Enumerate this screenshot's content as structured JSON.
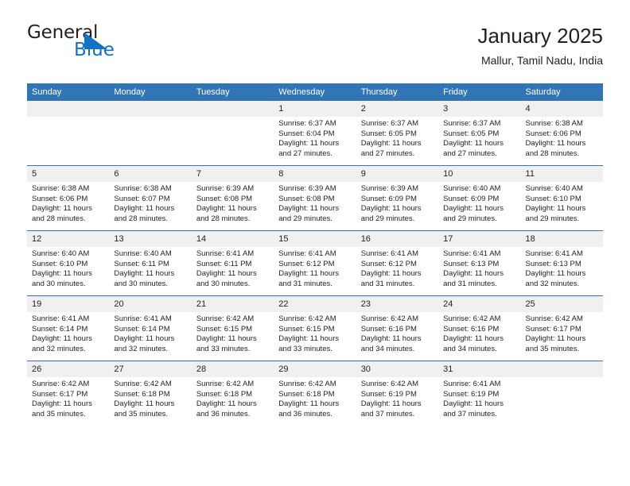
{
  "brand": {
    "name_part1": "General",
    "name_part2": "Blue",
    "mark": "triangle-icon"
  },
  "header": {
    "title": "January 2025",
    "location": "Mallur, Tamil Nadu, India"
  },
  "calendar": {
    "weekday_headers": [
      "Sunday",
      "Monday",
      "Tuesday",
      "Wednesday",
      "Thursday",
      "Friday",
      "Saturday"
    ],
    "accent_color": "#3275b6",
    "daynum_band_color": "#f0f0f0",
    "weeks": [
      [
        {
          "day": "",
          "sunrise": "",
          "sunset": "",
          "daylight1": "",
          "daylight2": ""
        },
        {
          "day": "",
          "sunrise": "",
          "sunset": "",
          "daylight1": "",
          "daylight2": ""
        },
        {
          "day": "",
          "sunrise": "",
          "sunset": "",
          "daylight1": "",
          "daylight2": ""
        },
        {
          "day": "1",
          "sunrise": "Sunrise: 6:37 AM",
          "sunset": "Sunset: 6:04 PM",
          "daylight1": "Daylight: 11 hours",
          "daylight2": "and 27 minutes."
        },
        {
          "day": "2",
          "sunrise": "Sunrise: 6:37 AM",
          "sunset": "Sunset: 6:05 PM",
          "daylight1": "Daylight: 11 hours",
          "daylight2": "and 27 minutes."
        },
        {
          "day": "3",
          "sunrise": "Sunrise: 6:37 AM",
          "sunset": "Sunset: 6:05 PM",
          "daylight1": "Daylight: 11 hours",
          "daylight2": "and 27 minutes."
        },
        {
          "day": "4",
          "sunrise": "Sunrise: 6:38 AM",
          "sunset": "Sunset: 6:06 PM",
          "daylight1": "Daylight: 11 hours",
          "daylight2": "and 28 minutes."
        }
      ],
      [
        {
          "day": "5",
          "sunrise": "Sunrise: 6:38 AM",
          "sunset": "Sunset: 6:06 PM",
          "daylight1": "Daylight: 11 hours",
          "daylight2": "and 28 minutes."
        },
        {
          "day": "6",
          "sunrise": "Sunrise: 6:38 AM",
          "sunset": "Sunset: 6:07 PM",
          "daylight1": "Daylight: 11 hours",
          "daylight2": "and 28 minutes."
        },
        {
          "day": "7",
          "sunrise": "Sunrise: 6:39 AM",
          "sunset": "Sunset: 6:08 PM",
          "daylight1": "Daylight: 11 hours",
          "daylight2": "and 28 minutes."
        },
        {
          "day": "8",
          "sunrise": "Sunrise: 6:39 AM",
          "sunset": "Sunset: 6:08 PM",
          "daylight1": "Daylight: 11 hours",
          "daylight2": "and 29 minutes."
        },
        {
          "day": "9",
          "sunrise": "Sunrise: 6:39 AM",
          "sunset": "Sunset: 6:09 PM",
          "daylight1": "Daylight: 11 hours",
          "daylight2": "and 29 minutes."
        },
        {
          "day": "10",
          "sunrise": "Sunrise: 6:40 AM",
          "sunset": "Sunset: 6:09 PM",
          "daylight1": "Daylight: 11 hours",
          "daylight2": "and 29 minutes."
        },
        {
          "day": "11",
          "sunrise": "Sunrise: 6:40 AM",
          "sunset": "Sunset: 6:10 PM",
          "daylight1": "Daylight: 11 hours",
          "daylight2": "and 29 minutes."
        }
      ],
      [
        {
          "day": "12",
          "sunrise": "Sunrise: 6:40 AM",
          "sunset": "Sunset: 6:10 PM",
          "daylight1": "Daylight: 11 hours",
          "daylight2": "and 30 minutes."
        },
        {
          "day": "13",
          "sunrise": "Sunrise: 6:40 AM",
          "sunset": "Sunset: 6:11 PM",
          "daylight1": "Daylight: 11 hours",
          "daylight2": "and 30 minutes."
        },
        {
          "day": "14",
          "sunrise": "Sunrise: 6:41 AM",
          "sunset": "Sunset: 6:11 PM",
          "daylight1": "Daylight: 11 hours",
          "daylight2": "and 30 minutes."
        },
        {
          "day": "15",
          "sunrise": "Sunrise: 6:41 AM",
          "sunset": "Sunset: 6:12 PM",
          "daylight1": "Daylight: 11 hours",
          "daylight2": "and 31 minutes."
        },
        {
          "day": "16",
          "sunrise": "Sunrise: 6:41 AM",
          "sunset": "Sunset: 6:12 PM",
          "daylight1": "Daylight: 11 hours",
          "daylight2": "and 31 minutes."
        },
        {
          "day": "17",
          "sunrise": "Sunrise: 6:41 AM",
          "sunset": "Sunset: 6:13 PM",
          "daylight1": "Daylight: 11 hours",
          "daylight2": "and 31 minutes."
        },
        {
          "day": "18",
          "sunrise": "Sunrise: 6:41 AM",
          "sunset": "Sunset: 6:13 PM",
          "daylight1": "Daylight: 11 hours",
          "daylight2": "and 32 minutes."
        }
      ],
      [
        {
          "day": "19",
          "sunrise": "Sunrise: 6:41 AM",
          "sunset": "Sunset: 6:14 PM",
          "daylight1": "Daylight: 11 hours",
          "daylight2": "and 32 minutes."
        },
        {
          "day": "20",
          "sunrise": "Sunrise: 6:41 AM",
          "sunset": "Sunset: 6:14 PM",
          "daylight1": "Daylight: 11 hours",
          "daylight2": "and 32 minutes."
        },
        {
          "day": "21",
          "sunrise": "Sunrise: 6:42 AM",
          "sunset": "Sunset: 6:15 PM",
          "daylight1": "Daylight: 11 hours",
          "daylight2": "and 33 minutes."
        },
        {
          "day": "22",
          "sunrise": "Sunrise: 6:42 AM",
          "sunset": "Sunset: 6:15 PM",
          "daylight1": "Daylight: 11 hours",
          "daylight2": "and 33 minutes."
        },
        {
          "day": "23",
          "sunrise": "Sunrise: 6:42 AM",
          "sunset": "Sunset: 6:16 PM",
          "daylight1": "Daylight: 11 hours",
          "daylight2": "and 34 minutes."
        },
        {
          "day": "24",
          "sunrise": "Sunrise: 6:42 AM",
          "sunset": "Sunset: 6:16 PM",
          "daylight1": "Daylight: 11 hours",
          "daylight2": "and 34 minutes."
        },
        {
          "day": "25",
          "sunrise": "Sunrise: 6:42 AM",
          "sunset": "Sunset: 6:17 PM",
          "daylight1": "Daylight: 11 hours",
          "daylight2": "and 35 minutes."
        }
      ],
      [
        {
          "day": "26",
          "sunrise": "Sunrise: 6:42 AM",
          "sunset": "Sunset: 6:17 PM",
          "daylight1": "Daylight: 11 hours",
          "daylight2": "and 35 minutes."
        },
        {
          "day": "27",
          "sunrise": "Sunrise: 6:42 AM",
          "sunset": "Sunset: 6:18 PM",
          "daylight1": "Daylight: 11 hours",
          "daylight2": "and 35 minutes."
        },
        {
          "day": "28",
          "sunrise": "Sunrise: 6:42 AM",
          "sunset": "Sunset: 6:18 PM",
          "daylight1": "Daylight: 11 hours",
          "daylight2": "and 36 minutes."
        },
        {
          "day": "29",
          "sunrise": "Sunrise: 6:42 AM",
          "sunset": "Sunset: 6:18 PM",
          "daylight1": "Daylight: 11 hours",
          "daylight2": "and 36 minutes."
        },
        {
          "day": "30",
          "sunrise": "Sunrise: 6:42 AM",
          "sunset": "Sunset: 6:19 PM",
          "daylight1": "Daylight: 11 hours",
          "daylight2": "and 37 minutes."
        },
        {
          "day": "31",
          "sunrise": "Sunrise: 6:41 AM",
          "sunset": "Sunset: 6:19 PM",
          "daylight1": "Daylight: 11 hours",
          "daylight2": "and 37 minutes."
        },
        {
          "day": "",
          "sunrise": "",
          "sunset": "",
          "daylight1": "",
          "daylight2": ""
        }
      ]
    ]
  }
}
